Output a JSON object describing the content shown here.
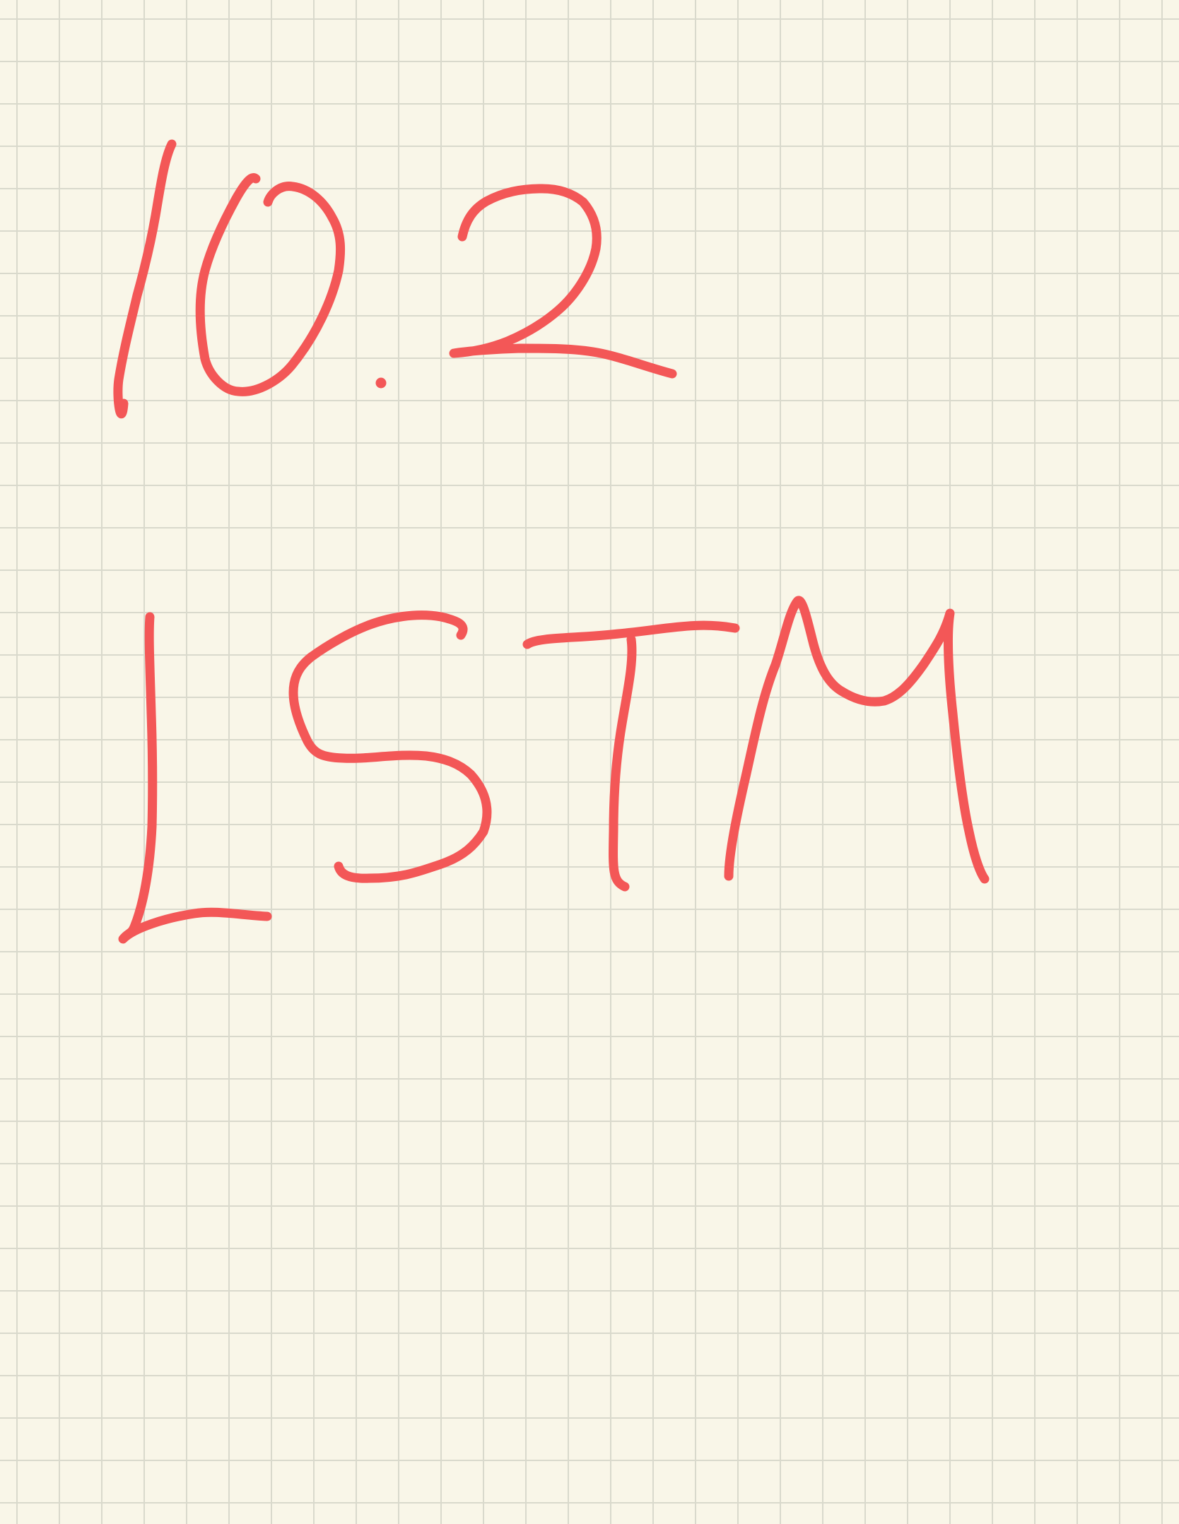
{
  "note": {
    "lines": [
      "10.2",
      "LSTM"
    ]
  },
  "colors": {
    "paper": "#f9f6e8",
    "grid": "#d9d9cc",
    "ink": "#f35757"
  }
}
